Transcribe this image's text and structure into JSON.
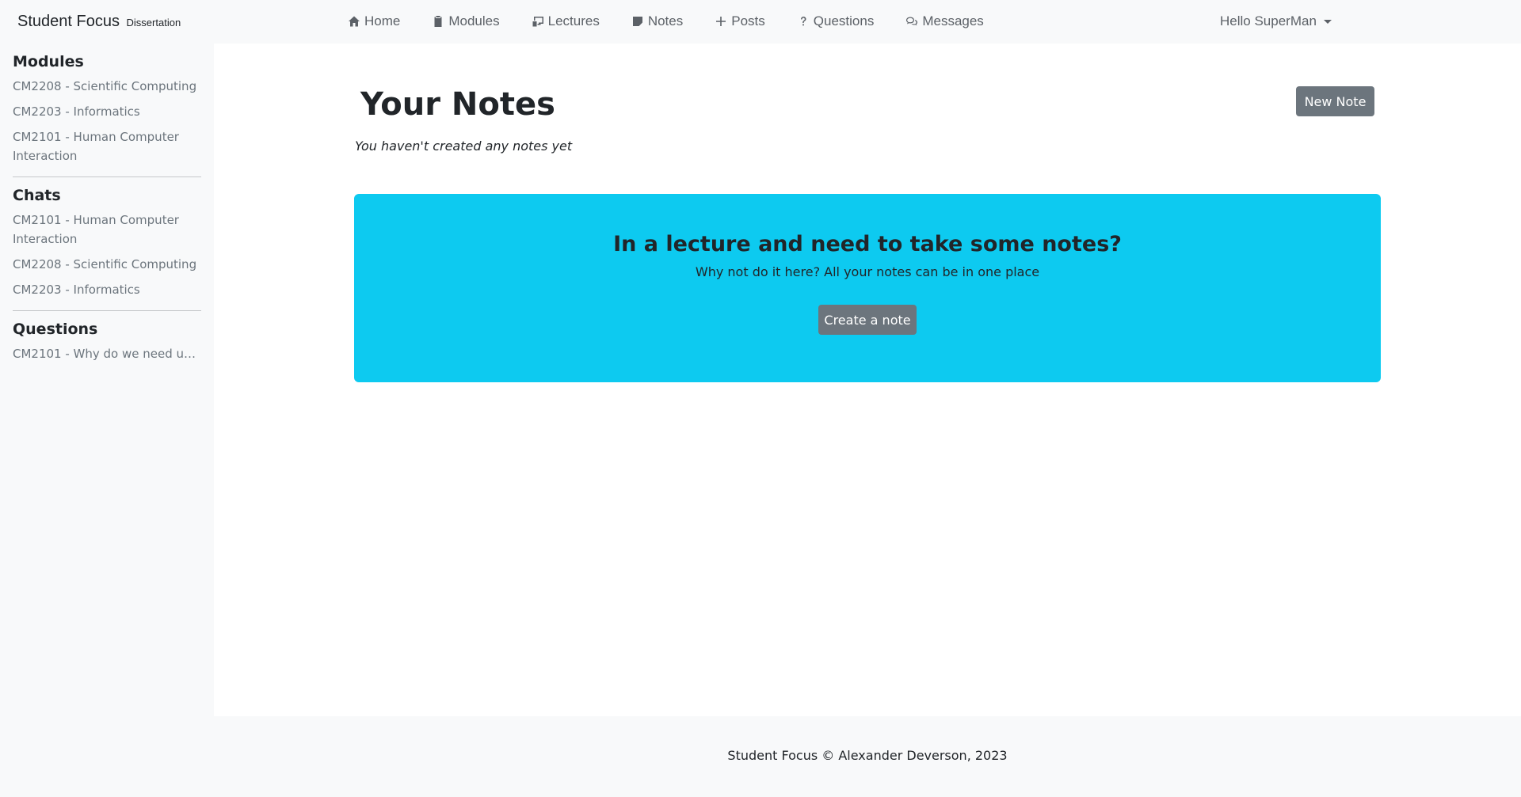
{
  "navbar": {
    "brand": "Student Focus",
    "brand_sub": "Dissertation",
    "links": [
      {
        "label": "Home",
        "icon": "house-icon"
      },
      {
        "label": "Modules",
        "icon": "clipboard-icon"
      },
      {
        "label": "Lectures",
        "icon": "easel-icon"
      },
      {
        "label": "Notes",
        "icon": "sticky-note-icon"
      },
      {
        "label": "Posts",
        "icon": "plus-icon"
      },
      {
        "label": "Questions",
        "icon": "question-icon"
      },
      {
        "label": "Messages",
        "icon": "chat-icon"
      }
    ],
    "user_greeting": "Hello SuperMan"
  },
  "sidebar": {
    "modules": {
      "title": "Modules",
      "items": [
        "CM2208 - Scientific Computing",
        "CM2203 - Informatics",
        "CM2101 - Human Computer Interaction"
      ]
    },
    "chats": {
      "title": "Chats",
      "items": [
        "CM2101 - Human Computer Interaction",
        "CM2208 - Scientific Computing",
        "CM2203 - Informatics"
      ]
    },
    "questions": {
      "title": "Questions",
      "items": [
        "CM2101 - Why do we need use..."
      ]
    }
  },
  "main": {
    "title": "Your Notes",
    "new_note_label": "New Note",
    "empty_message": "You haven't created any notes yet",
    "banner": {
      "heading": "In a lecture and need to take some notes?",
      "text": "Why not do it here? All your notes can be in one place",
      "button_label": "Create a note"
    }
  },
  "footer": {
    "text": "Student Focus © Alexander Deverson, 2023"
  },
  "colors": {
    "banner": "#0dcaf0",
    "button": "#6c757d",
    "background": "#f8f9fa"
  }
}
